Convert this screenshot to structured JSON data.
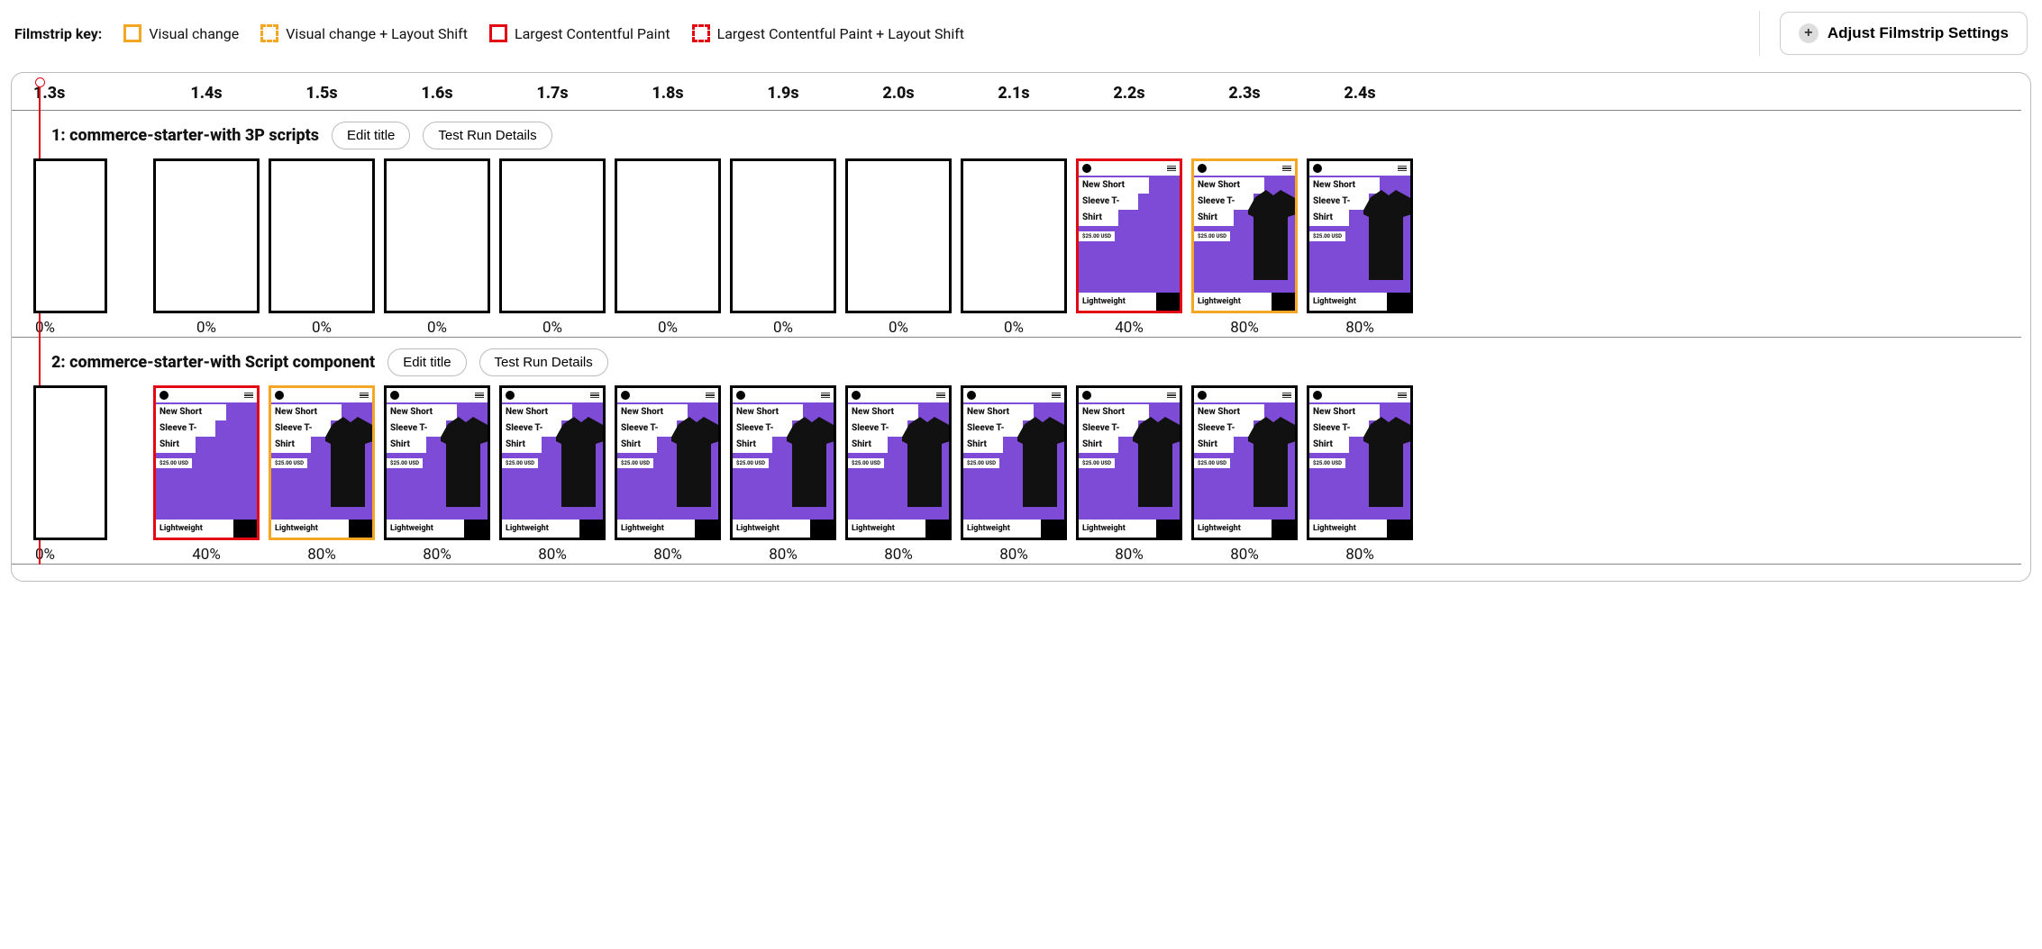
{
  "key": {
    "label": "Filmstrip key:",
    "items": [
      {
        "swatch": "orange-solid",
        "text": "Visual change"
      },
      {
        "swatch": "orange-dashed",
        "text": "Visual change + Layout Shift"
      },
      {
        "swatch": "red-solid",
        "text": "Largest Contentful Paint"
      },
      {
        "swatch": "red-dashed",
        "text": "Largest Contentful Paint + Layout Shift"
      }
    ]
  },
  "adjust_button": "Adjust Filmstrip Settings",
  "timestamps": [
    "1.3s",
    "1.4s",
    "1.5s",
    "1.6s",
    "1.7s",
    "1.8s",
    "1.9s",
    "2.0s",
    "2.1s",
    "2.2s",
    "2.3s",
    "2.4s"
  ],
  "product": {
    "title_l1": "New Short",
    "title_l2": "Sleeve T-",
    "title_l3": "Shirt",
    "price": "$25.00 USD",
    "badge": "Lightweight"
  },
  "buttons": {
    "edit_title": "Edit title",
    "test_run_details": "Test Run Details"
  },
  "runs": [
    {
      "title": "1: commerce-starter-with 3P scripts",
      "frames": [
        {
          "pct": "0%",
          "content": "blank",
          "border": "black",
          "narrow": true
        },
        {
          "pct": "0%",
          "content": "blank",
          "border": "black"
        },
        {
          "pct": "0%",
          "content": "blank",
          "border": "black"
        },
        {
          "pct": "0%",
          "content": "blank",
          "border": "black"
        },
        {
          "pct": "0%",
          "content": "blank",
          "border": "black"
        },
        {
          "pct": "0%",
          "content": "blank",
          "border": "black"
        },
        {
          "pct": "0%",
          "content": "blank",
          "border": "black"
        },
        {
          "pct": "0%",
          "content": "blank",
          "border": "black"
        },
        {
          "pct": "0%",
          "content": "blank",
          "border": "black"
        },
        {
          "pct": "40%",
          "content": "product-noshirt",
          "border": "red"
        },
        {
          "pct": "80%",
          "content": "product",
          "border": "orange"
        },
        {
          "pct": "80%",
          "content": "product",
          "border": "black"
        }
      ]
    },
    {
      "title": "2: commerce-starter-with Script component",
      "frames": [
        {
          "pct": "0%",
          "content": "blank",
          "border": "black",
          "narrow": true
        },
        {
          "pct": "40%",
          "content": "product-noshirt",
          "border": "red"
        },
        {
          "pct": "80%",
          "content": "product",
          "border": "orange"
        },
        {
          "pct": "80%",
          "content": "product",
          "border": "black"
        },
        {
          "pct": "80%",
          "content": "product",
          "border": "black"
        },
        {
          "pct": "80%",
          "content": "product",
          "border": "black"
        },
        {
          "pct": "80%",
          "content": "product",
          "border": "black"
        },
        {
          "pct": "80%",
          "content": "product",
          "border": "black"
        },
        {
          "pct": "80%",
          "content": "product",
          "border": "black"
        },
        {
          "pct": "80%",
          "content": "product",
          "border": "black"
        },
        {
          "pct": "80%",
          "content": "product",
          "border": "black"
        },
        {
          "pct": "80%",
          "content": "product",
          "border": "black"
        }
      ]
    }
  ]
}
